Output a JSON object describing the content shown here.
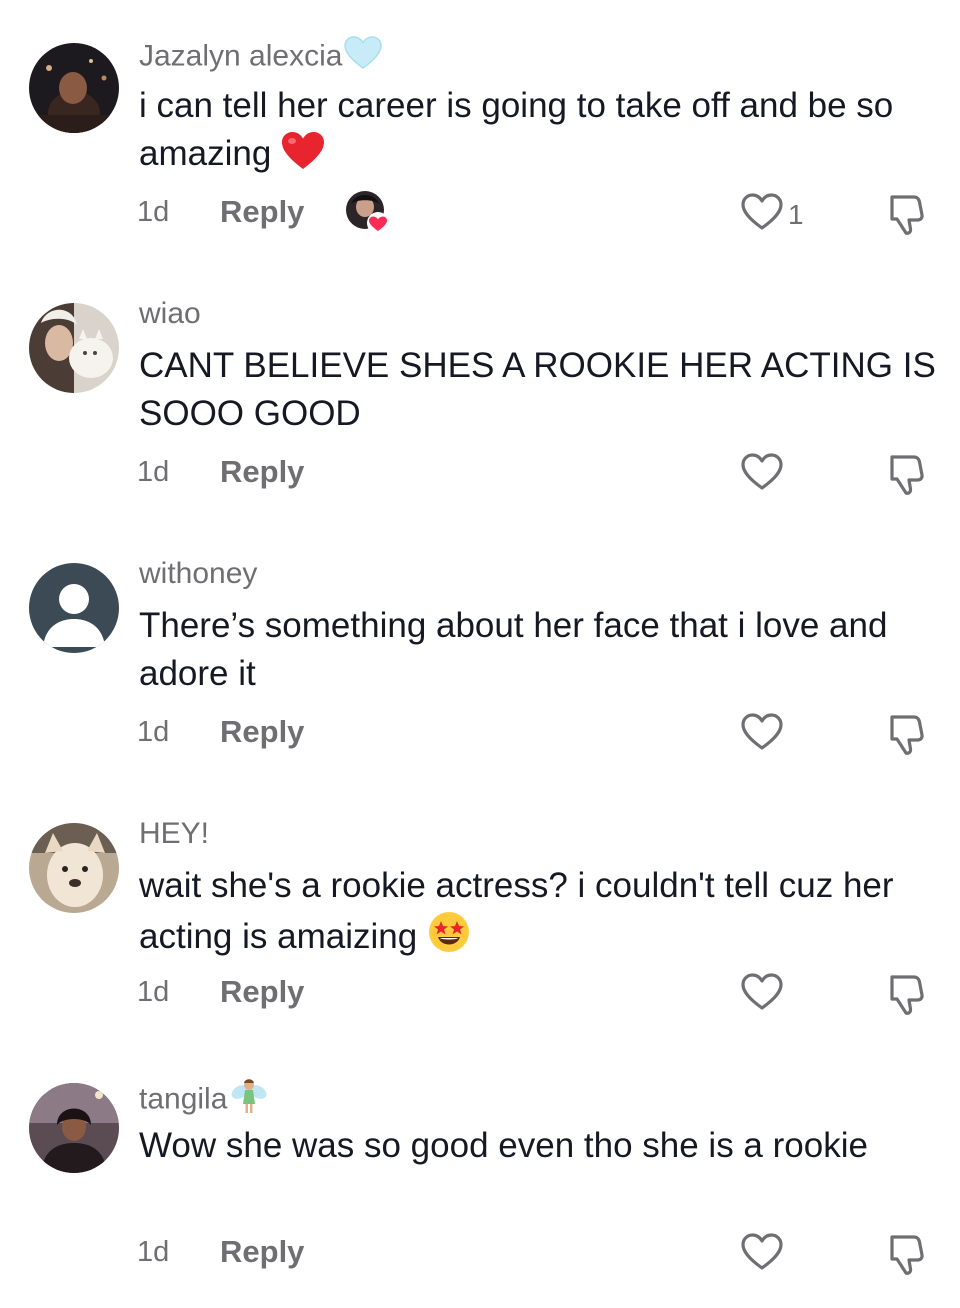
{
  "comments": [
    {
      "username": "Jazalyn alexcia",
      "username_badge": "light-blue-heart-icon",
      "text": "i can tell her career is going to take off and be so amazing",
      "text_emoji": "red-heart-emoji",
      "time": "1d",
      "reply_label": "Reply",
      "liked_by_creator": true,
      "like_count": "1"
    },
    {
      "username": "wiao",
      "text": "CANT BELIEVE SHES A ROOKIE HER ACTING IS SOOO GOOD",
      "time": "1d",
      "reply_label": "Reply",
      "like_count": ""
    },
    {
      "username": "withoney",
      "text": "There’s something about her face that i love and adore it",
      "time": "1d",
      "reply_label": "Reply",
      "like_count": ""
    },
    {
      "username": "HEY!",
      "text": "wait she's a rookie actress? i couldn't tell cuz her acting is amaizing",
      "text_emoji": "star-struck-emoji",
      "time": "1d",
      "reply_label": "Reply",
      "like_count": ""
    },
    {
      "username": "tangila",
      "username_badge": "fairy-emoji",
      "text": "Wow she was so good even tho she is a rookie",
      "time": "1d",
      "reply_label": "Reply",
      "like_count": ""
    }
  ],
  "colors": {
    "primary_text": "#161823",
    "secondary_text": "#6f6f73",
    "like_accent": "#fe2c55"
  }
}
